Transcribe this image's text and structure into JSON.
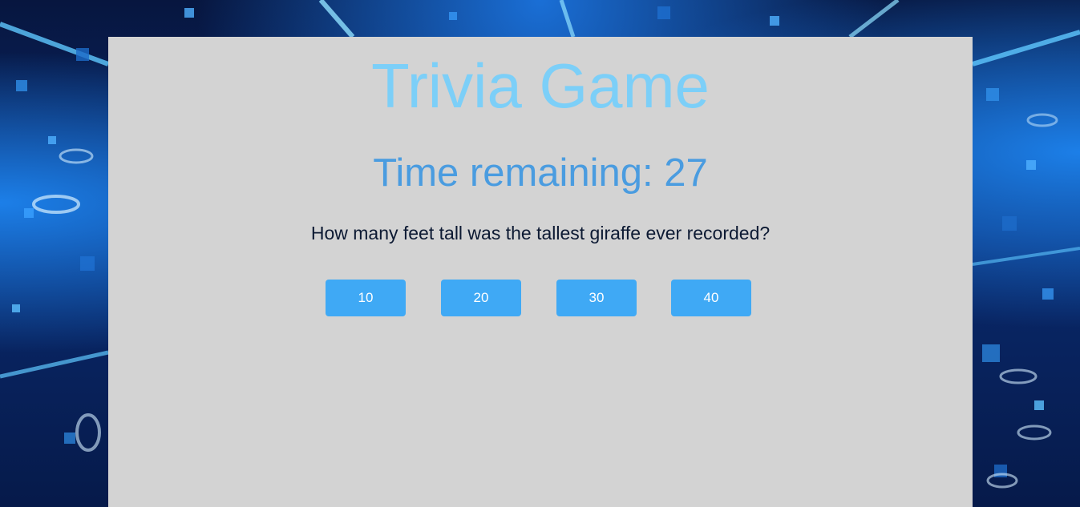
{
  "page": {
    "title": "Trivia Game",
    "timer_label": "Time remaining: 27",
    "question": "How many feet tall was the tallest giraffe ever recorded?",
    "answers": [
      "10",
      "20",
      "30",
      "40"
    ]
  },
  "colors": {
    "panel_bg": "#d3d3d3",
    "title": "#7ccff8",
    "timer": "#4a9ce0",
    "button_bg": "#3fa9f5",
    "button_text": "#ffffff"
  },
  "background": {
    "description_icon": "digital-binary-background"
  }
}
